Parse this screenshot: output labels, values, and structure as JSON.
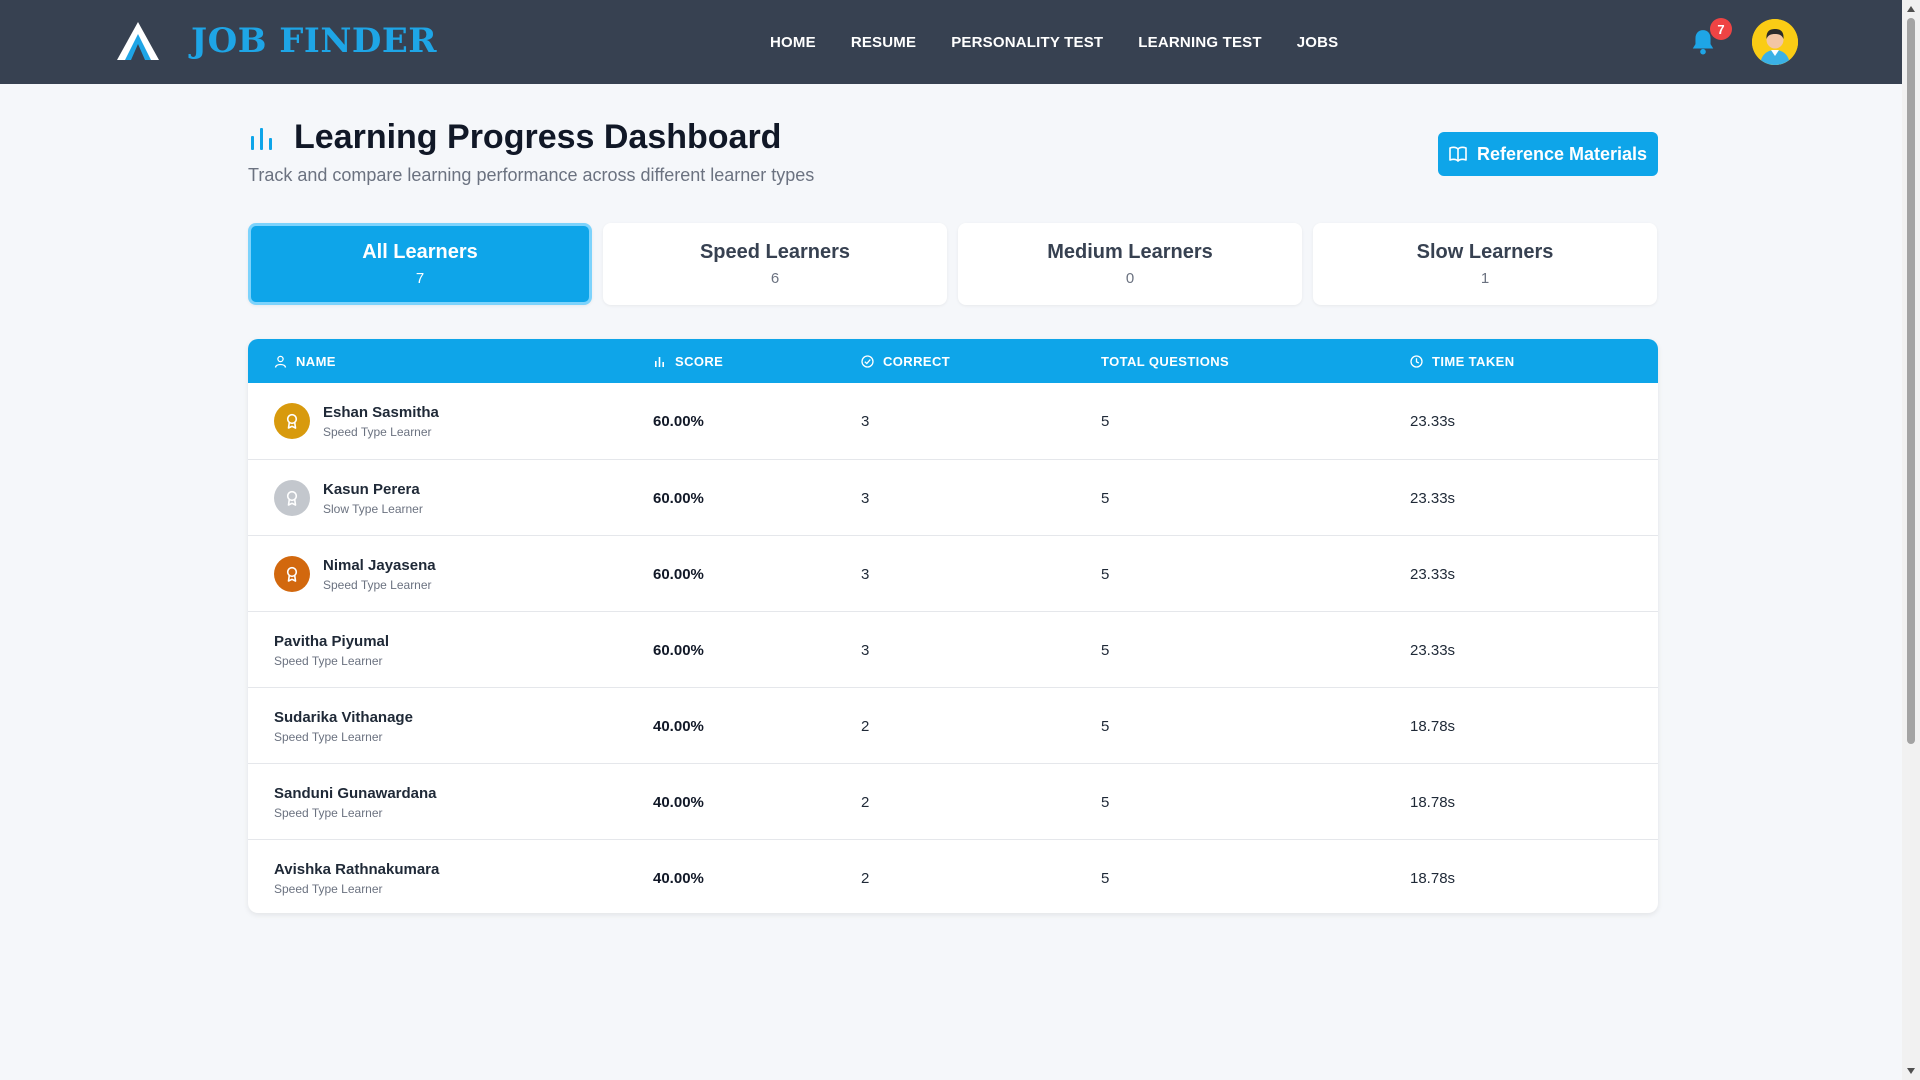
{
  "brand": {
    "name": "JOB FINDER"
  },
  "nav": {
    "items": [
      {
        "label": "HOME"
      },
      {
        "label": "RESUME"
      },
      {
        "label": "PERSONALITY TEST"
      },
      {
        "label": "LEARNING TEST"
      },
      {
        "label": "JOBS"
      }
    ],
    "notification_count": "7"
  },
  "header": {
    "title": "Learning Progress Dashboard",
    "subtitle": "Track and compare learning performance across different learner types",
    "reference_button": "Reference Materials"
  },
  "tabs": [
    {
      "label": "All Learners",
      "count": "7",
      "active": true
    },
    {
      "label": "Speed Learners",
      "count": "6",
      "active": false
    },
    {
      "label": "Medium Learners",
      "count": "0",
      "active": false
    },
    {
      "label": "Slow Learners",
      "count": "1",
      "active": false
    }
  ],
  "table": {
    "headers": {
      "name": "NAME",
      "score": "SCORE",
      "correct": "CORRECT",
      "total": "TOTAL QUESTIONS",
      "time": "TIME TAKEN"
    },
    "rows": [
      {
        "name": "Eshan Sasmitha",
        "type": "Speed Type Learner",
        "score": "60.00%",
        "correct": "3",
        "total": "5",
        "time": "23.33s",
        "medal": "gold"
      },
      {
        "name": "Kasun Perera",
        "type": "Slow Type Learner",
        "score": "60.00%",
        "correct": "3",
        "total": "5",
        "time": "23.33s",
        "medal": "silver"
      },
      {
        "name": "Nimal Jayasena",
        "type": "Speed Type Learner",
        "score": "60.00%",
        "correct": "3",
        "total": "5",
        "time": "23.33s",
        "medal": "bronze"
      },
      {
        "name": "Pavitha Piyumal",
        "type": "Speed Type Learner",
        "score": "60.00%",
        "correct": "3",
        "total": "5",
        "time": "23.33s",
        "medal": "none"
      },
      {
        "name": "Sudarika Vithanage",
        "type": "Speed Type Learner",
        "score": "40.00%",
        "correct": "2",
        "total": "5",
        "time": "18.78s",
        "medal": "none"
      },
      {
        "name": "Sanduni Gunawardana",
        "type": "Speed Type Learner",
        "score": "40.00%",
        "correct": "2",
        "total": "5",
        "time": "18.78s",
        "medal": "none"
      },
      {
        "name": "Avishka Rathnakumara",
        "type": "Speed Type Learner",
        "score": "40.00%",
        "correct": "2",
        "total": "5",
        "time": "18.78s",
        "medal": "none"
      }
    ]
  },
  "colors": {
    "navbar": "#374151",
    "accent": "#0ea5e9",
    "brand": "#1ea5e6",
    "badge": "#ef4444",
    "gold": "#d89a0d",
    "silver": "#c3c7cd",
    "bronze": "#d2680e"
  },
  "icons": {
    "logo": "mountain-logo-icon",
    "bell": "bell-icon",
    "avatar": "user-avatar-icon",
    "title": "bar-chart-icon",
    "reference": "book-open-icon",
    "name_header": "user-icon",
    "score_header": "bar-chart-icon",
    "correct_header": "check-circle-icon",
    "time_header": "clock-icon",
    "medal": "award-icon"
  }
}
